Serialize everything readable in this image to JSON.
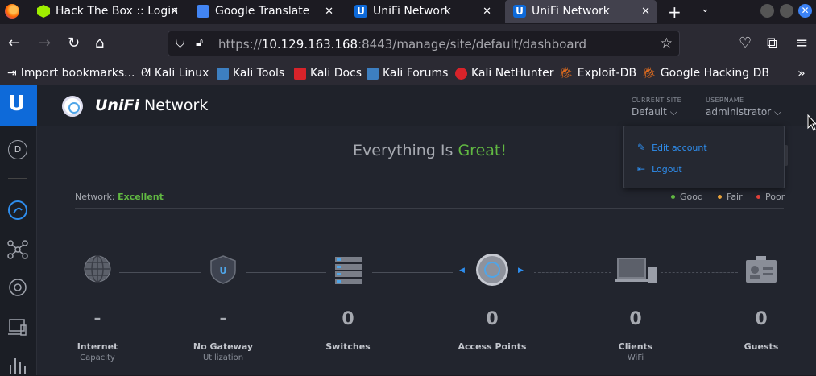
{
  "browser": {
    "tabs": [
      {
        "title": "Hack The Box :: Login",
        "color": "#9fef00",
        "active": false
      },
      {
        "title": "Google Translate",
        "color": "#4285f4",
        "active": false
      },
      {
        "title": "UniFi Network",
        "color": "#0e6ad9",
        "active": false
      },
      {
        "title": "UniFi Network",
        "color": "#0e6ad9",
        "active": true
      }
    ],
    "url_prefix": "https://",
    "url_host": "10.129.163.168",
    "url_rest": ":8443/manage/site/default/dashboard",
    "bookmarks": [
      {
        "label": "Import bookmarks...",
        "color": "#fbfbfe"
      },
      {
        "label": "Kali Linux",
        "color": "#3d7fc1"
      },
      {
        "label": "Kali Tools",
        "color": "#3d7fc1"
      },
      {
        "label": "Kali Docs",
        "color": "#d8232a"
      },
      {
        "label": "Kali Forums",
        "color": "#3d7fc1"
      },
      {
        "label": "Kali NetHunter",
        "color": "#d8232a"
      },
      {
        "label": "Exploit-DB",
        "color": "#e06c1e"
      },
      {
        "label": "Google Hacking DB",
        "color": "#e06c1e"
      }
    ]
  },
  "app": {
    "brand_text_italic": "UniFi",
    "brand_text": " Network",
    "current_site_label": "CURRENT SITE",
    "current_site_value": "Default",
    "username_label": "USERNAME",
    "username_value": "administrator",
    "dropdown": {
      "edit_account": "Edit account",
      "logout": "Logout"
    },
    "headline_prefix": "Everything Is ",
    "headline_status": "Great!",
    "network_label": "Network:",
    "network_status": "Excellent",
    "legend": [
      {
        "label": "Good",
        "color": "#61b842"
      },
      {
        "label": "Fair",
        "color": "#e8a23a"
      },
      {
        "label": "Poor",
        "color": "#e0403a"
      }
    ],
    "stats": [
      {
        "value": "-",
        "label": "Internet",
        "sub": "Capacity"
      },
      {
        "value": "-",
        "label": "No Gateway",
        "sub": "Utilization"
      },
      {
        "value": "0",
        "label": "Switches",
        "sub": ""
      },
      {
        "value": "0",
        "label": "Access Points",
        "sub": ""
      },
      {
        "value": "0",
        "label": "Clients",
        "sub": "WiFi"
      },
      {
        "value": "0",
        "label": "Guests",
        "sub": ""
      }
    ]
  }
}
